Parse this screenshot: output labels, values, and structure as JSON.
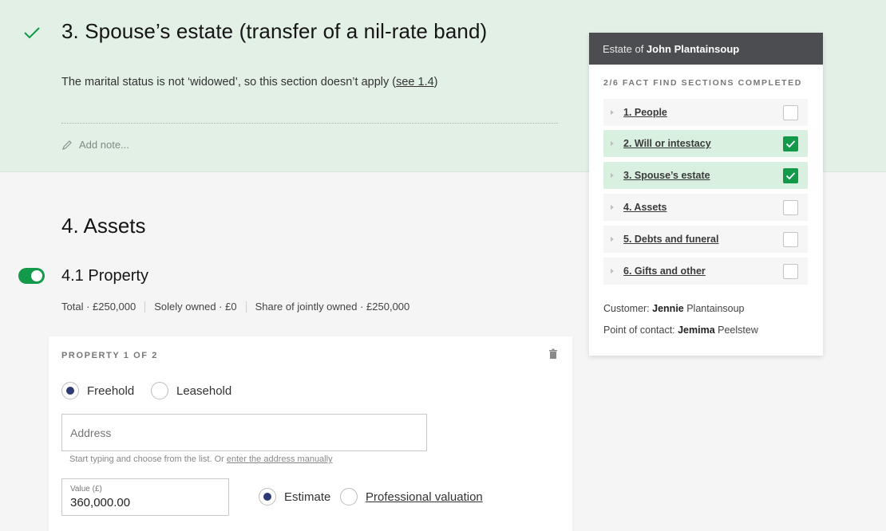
{
  "section3": {
    "title": "3. Spouse’s estate (transfer of a nil-rate band)",
    "text": "The marital status is not ‘widowed’, so this section doesn’t apply (",
    "link": "see 1.4",
    "text_end": ")",
    "add_note": "Add note..."
  },
  "section4": {
    "title": "4. Assets",
    "property_title": "4.1 Property",
    "property_enabled": true,
    "totals": {
      "total": "Total · £250,000",
      "solely": "Solely owned · £0",
      "joint": "Share of jointly owned · £250,000"
    }
  },
  "property_card": {
    "heading": "PROPERTY 1 OF 2",
    "tenure_options": [
      "Freehold",
      "Leasehold"
    ],
    "tenure_selected": "Freehold",
    "address_placeholder": "Address",
    "address_help": "Start typing and choose from the list. Or ",
    "address_help_link": "enter the address manually",
    "value_label": "Value (£)",
    "value": "360,000.00",
    "valuation_options": [
      "Estimate",
      "Professional valuation"
    ],
    "valuation_selected": "Estimate"
  },
  "panel": {
    "header_prefix": "Estate of ",
    "header_name": "John Plantainsoup",
    "progress": "2/6 FACT FIND SECTIONS COMPLETED",
    "sections": [
      {
        "label": "1. People",
        "done": false
      },
      {
        "label": "2. Will or intestacy",
        "done": true
      },
      {
        "label": "3. Spouse’s estate",
        "done": true
      },
      {
        "label": "4. Assets",
        "done": false
      },
      {
        "label": "5. Debts and funeral",
        "done": false
      },
      {
        "label": "6. Gifts and other",
        "done": false
      }
    ],
    "customer_label": "Customer: ",
    "customer_first": "Jennie",
    "customer_last": " Plantainsoup",
    "contact_label": "Point of contact: ",
    "contact_first": "Jemima",
    "contact_last": " Peelstew"
  },
  "colors": {
    "accent_green": "#12994a",
    "band_green": "#e2f0e6",
    "radio_navy": "#2e3a74",
    "panel_header": "#4b4d50"
  }
}
